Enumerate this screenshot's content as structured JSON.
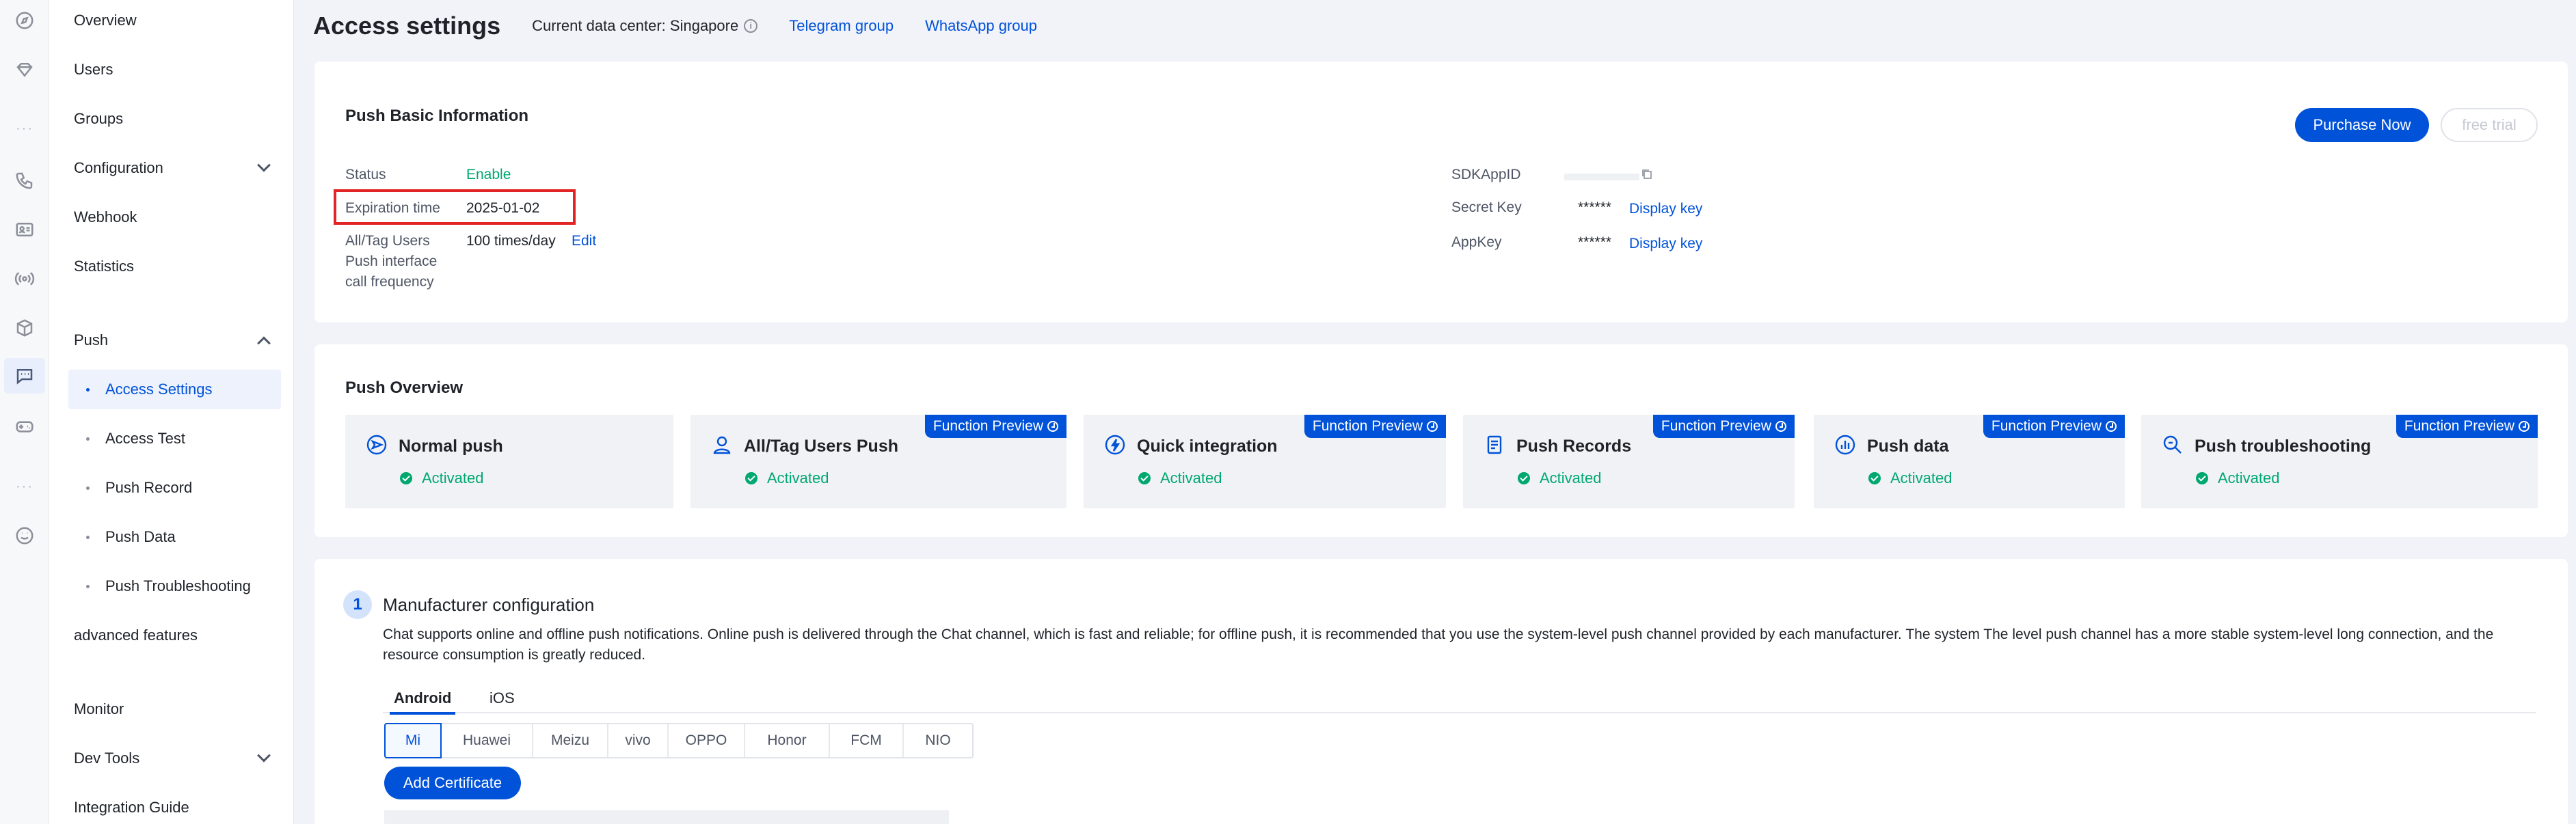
{
  "rail": {
    "icons": [
      "compass-icon",
      "gem-icon",
      "phone-icon",
      "id-card-icon",
      "broadcast-icon",
      "cube-icon",
      "chat-icon",
      "gamepad-icon",
      "smile-icon"
    ]
  },
  "sidebar": {
    "items": {
      "overview": "Overview",
      "users": "Users",
      "groups": "Groups",
      "configuration": "Configuration",
      "webhook": "Webhook",
      "statistics": "Statistics",
      "push": "Push",
      "access_settings": "Access Settings",
      "access_test": "Access Test",
      "push_record": "Push Record",
      "push_data": "Push Data",
      "push_troubleshooting": "Push Troubleshooting",
      "advanced_features": "advanced features",
      "monitor": "Monitor",
      "dev_tools": "Dev Tools",
      "integration_guide": "Integration Guide"
    }
  },
  "header": {
    "title": "Access settings",
    "data_center": "Current data center: Singapore",
    "telegram": "Telegram group",
    "whatsapp": "WhatsApp group"
  },
  "basic_info": {
    "title": "Push Basic Information",
    "status_label": "Status",
    "status_value": "Enable",
    "expiration_label": "Expiration time",
    "expiration_value": "2025-01-02",
    "frequency_label_1": "All/Tag Users",
    "frequency_label_2": "Push interface",
    "frequency_label_3": "call frequency",
    "frequency_value": "100 times/day",
    "edit": "Edit",
    "sdkappid_label": "SDKAppID",
    "secret_label": "Secret Key",
    "secret_mask": "******",
    "appkey_label": "AppKey",
    "appkey_mask": "******",
    "display_key": "Display key",
    "purchase": "Purchase Now",
    "free_trial": "free trial"
  },
  "overview": {
    "title": "Push Overview",
    "badge": "Function Preview",
    "tiles": [
      {
        "title": "Normal push",
        "status": "Activated",
        "icon": "send-icon"
      },
      {
        "title": "All/Tag Users Push",
        "status": "Activated",
        "icon": "user-icon"
      },
      {
        "title": "Quick integration",
        "status": "Activated",
        "icon": "bolt-icon"
      },
      {
        "title": "Push Records",
        "status": "Activated",
        "icon": "document-icon"
      },
      {
        "title": "Push data",
        "status": "Activated",
        "icon": "chart-icon"
      },
      {
        "title": "Push troubleshooting",
        "status": "Activated",
        "icon": "search-icon"
      }
    ]
  },
  "manufacturer": {
    "step": "1",
    "title": "Manufacturer configuration",
    "description": "Chat supports online and offline push notifications. Online push is delivered through the Chat channel, which is fast and reliable; for offline push, it is recommended that you use the system-level push channel provided by each manufacturer. The system The level push channel has a more stable system-level long connection, and the resource consumption is greatly reduced.",
    "tabs": [
      "Android",
      "iOS"
    ],
    "vendors": [
      "Mi",
      "Huawei",
      "Meizu",
      "vivo",
      "OPPO",
      "Honor",
      "FCM",
      "NIO"
    ],
    "add_certificate": "Add Certificate"
  },
  "colors": {
    "accent": "#0052d9",
    "success": "#00a870",
    "highlight": "#e32424"
  }
}
